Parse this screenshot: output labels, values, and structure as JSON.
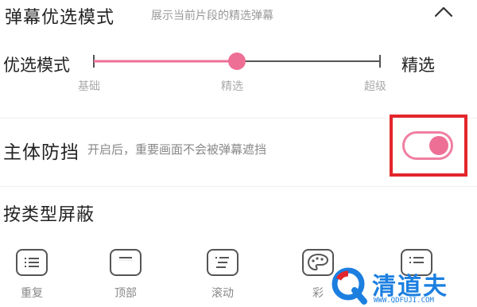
{
  "barrage_preference": {
    "title": "弹幕优选模式",
    "description": "展示当前片段的精选弹幕",
    "collapse_icon": "chevron-up-icon"
  },
  "slider": {
    "label": "优选模式",
    "value_label": "精选",
    "value_fraction": 0.5,
    "ticks": [
      "基础",
      "精选",
      "超级"
    ],
    "accent_color": "#ee6f95",
    "track_color": "#555555"
  },
  "subject_block": {
    "title": "主体防挡",
    "description": "开启后，重要画面不会被弹幕遮挡",
    "enabled": true,
    "toggle_color": "#ee6f95",
    "highlight_color": "#e3262b"
  },
  "block_by_type": {
    "title": "按类型屏蔽",
    "items": [
      {
        "label": "重复",
        "icon": "repeat-list-icon"
      },
      {
        "label": "顶部",
        "icon": "top-bar-icon"
      },
      {
        "label": "滚动",
        "icon": "scroll-list-icon"
      },
      {
        "label": "彩",
        "icon": "palette-icon"
      },
      {
        "label": "",
        "icon": "list-icon"
      }
    ]
  },
  "watermark": {
    "text": "清道夫",
    "url": "WWW.QDFUJI.COM",
    "color": "#1c7fe0"
  }
}
